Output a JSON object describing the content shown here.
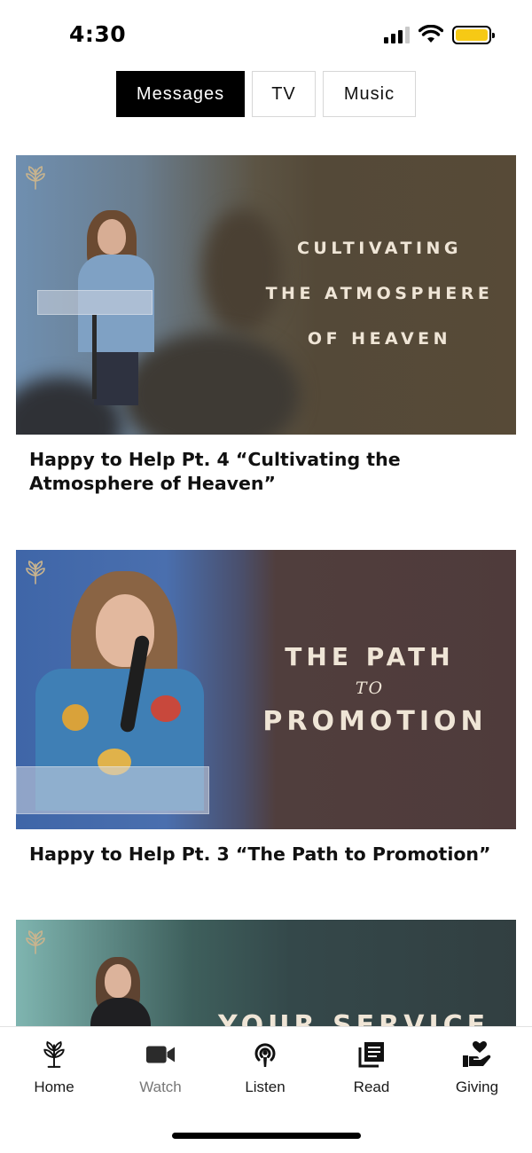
{
  "status_bar": {
    "time": "4:30",
    "battery_level": 1.0,
    "battery_color": "#f6c915"
  },
  "tabs": [
    {
      "label": "Messages",
      "active": true
    },
    {
      "label": "TV",
      "active": false
    },
    {
      "label": "Music",
      "active": false
    }
  ],
  "feed": {
    "cards": [
      {
        "overlay_lines": [
          "CULTIVATING",
          "THE ATMOSPHERE",
          "OF HEAVEN"
        ],
        "title": "Happy to Help Pt. 4 “Cultivating the Atmosphere of Heaven”"
      },
      {
        "overlay_line1": "THE PATH",
        "overlay_to": "TO",
        "overlay_line2": "PROMOTION",
        "title": "Happy to Help Pt. 3 “The Path to Promotion”"
      },
      {
        "overlay_partial": "YOUR SERVICE"
      }
    ]
  },
  "bottom_nav": [
    {
      "label": "Home",
      "icon": "leaf-sprig-icon"
    },
    {
      "label": "Watch",
      "icon": "video-camera-icon",
      "muted": true
    },
    {
      "label": "Listen",
      "icon": "podcast-icon"
    },
    {
      "label": "Read",
      "icon": "book-stack-icon"
    },
    {
      "label": "Giving",
      "icon": "heart-hand-icon"
    }
  ],
  "colors": {
    "accent_dark": "#000000",
    "overlay_text": "#efe5d6",
    "brand_leaf": "#c9b48e"
  }
}
